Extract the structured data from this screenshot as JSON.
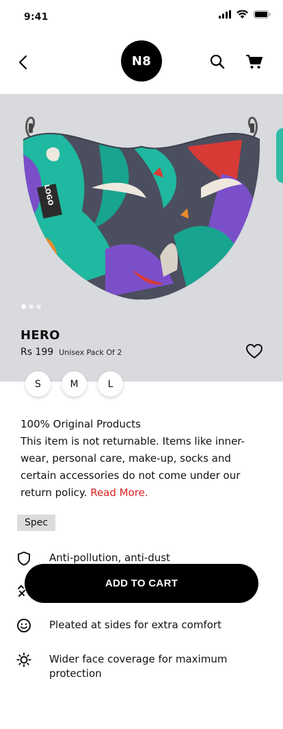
{
  "status_bar": {
    "time": "9:41"
  },
  "header": {
    "logo_text": "N8"
  },
  "product": {
    "name": "HERO",
    "price": "Rs 199",
    "pack": "Unisex Pack Of 2",
    "mask_logo_text": "LOGO",
    "sizes": [
      "S",
      "M",
      "L"
    ],
    "carousel_count": 3,
    "carousel_active": 0
  },
  "description": {
    "heading": "100% Original Products",
    "body": "This item is not returnable. Items like inner-wear, personal care, make-up, socks and certain accessories do not come under our return policy.",
    "read_more": "Read More."
  },
  "spec": {
    "label": "Spec",
    "features": [
      {
        "icon": "shield-icon",
        "text": "Anti-pollution, anti-dust"
      },
      {
        "icon": "tool-icon",
        "text": ""
      },
      {
        "icon": "smile-icon",
        "text": "Pleated at sides for extra comfort"
      },
      {
        "icon": "sun-icon",
        "text": "Wider face coverage for maximum protection"
      }
    ]
  },
  "cta": {
    "add_to_cart": "ADD TO CART"
  },
  "colors": {
    "hero_bg": "#d8dadd",
    "accent_red": "#e02020",
    "mask_teal": "#1fb8a0",
    "mask_purple": "#7b4fc9",
    "mask_dark": "#4b4e5e"
  }
}
